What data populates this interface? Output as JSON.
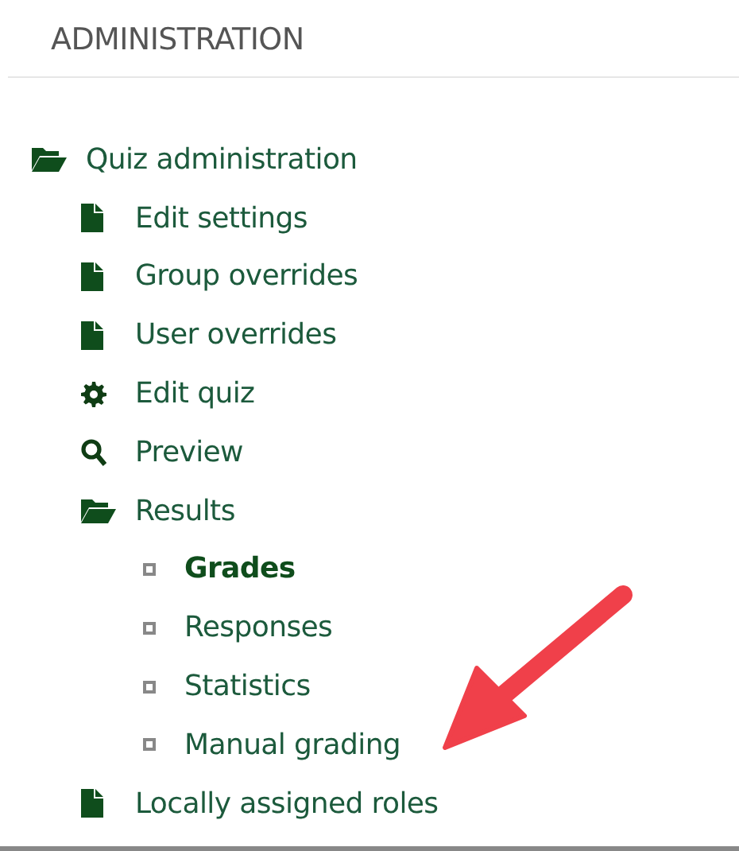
{
  "block": {
    "title": "ADMINISTRATION",
    "tree": [
      {
        "label": "Quiz administration",
        "kind": "folder",
        "children": [
          {
            "label": "Edit settings",
            "kind": "file"
          },
          {
            "label": "Group overrides",
            "kind": "file"
          },
          {
            "label": "User overrides",
            "kind": "file"
          },
          {
            "label": "Edit quiz",
            "kind": "gear"
          },
          {
            "label": "Preview",
            "kind": "search"
          },
          {
            "label": "Results",
            "kind": "folder",
            "children": [
              {
                "label": "Grades",
                "kind": "bullet",
                "selected": true
              },
              {
                "label": "Responses",
                "kind": "bullet",
                "selected": false
              },
              {
                "label": "Statistics",
                "kind": "bullet",
                "selected": false
              },
              {
                "label": "Manual grading",
                "kind": "bullet",
                "selected": false
              }
            ]
          },
          {
            "label": "Locally assigned roles",
            "kind": "file"
          }
        ]
      }
    ]
  }
}
